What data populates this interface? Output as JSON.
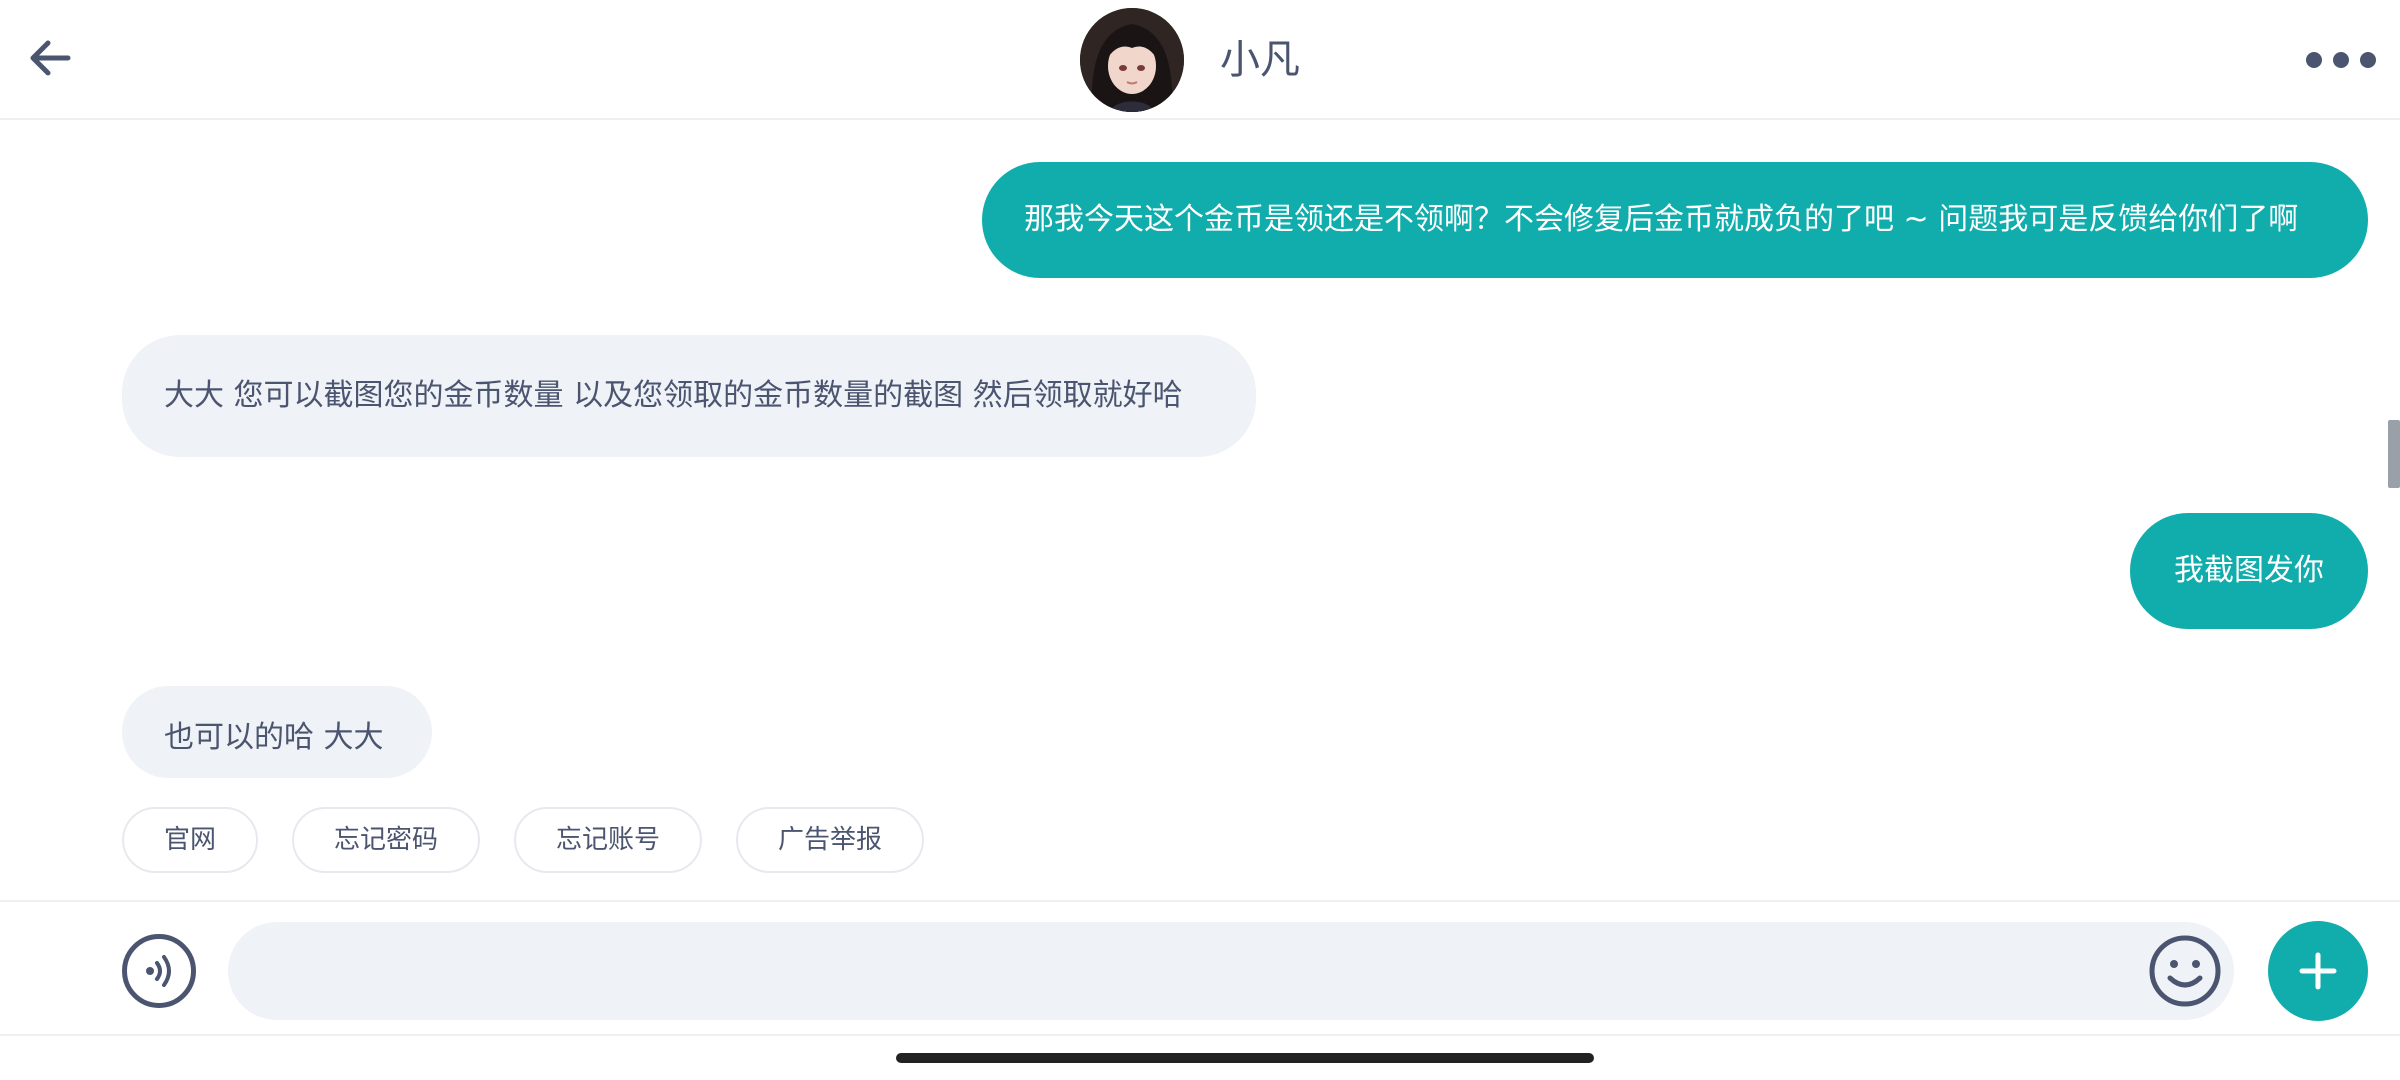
{
  "header": {
    "back_icon": "arrow-left-icon",
    "contact_name": "小凡",
    "more_icon": "more-horizontal-icon"
  },
  "messages": [
    {
      "direction": "out",
      "text": "那我今天这个金币是领还是不领啊？不会修复后金币就成负的了吧 ~ 问题我可是反馈给你们了啊"
    },
    {
      "direction": "in",
      "text": "大大 您可以截图您的金币数量 以及您领取的金币数量的截图 然后领取就好哈"
    },
    {
      "direction": "out",
      "text": "我截图发你"
    },
    {
      "direction": "in",
      "text": "也可以的哈 大大"
    }
  ],
  "quick_replies": [
    "官网",
    "忘记密码",
    "忘记账号",
    "广告举报"
  ],
  "input_bar": {
    "voice_icon": "voice-icon",
    "message_value": "",
    "emoji_icon": "emoji-smile-icon",
    "plus_icon": "plus-icon"
  },
  "colors": {
    "accent": "#11adad",
    "incoming_bubble": "#eff2f6",
    "text": "#4b5570"
  }
}
